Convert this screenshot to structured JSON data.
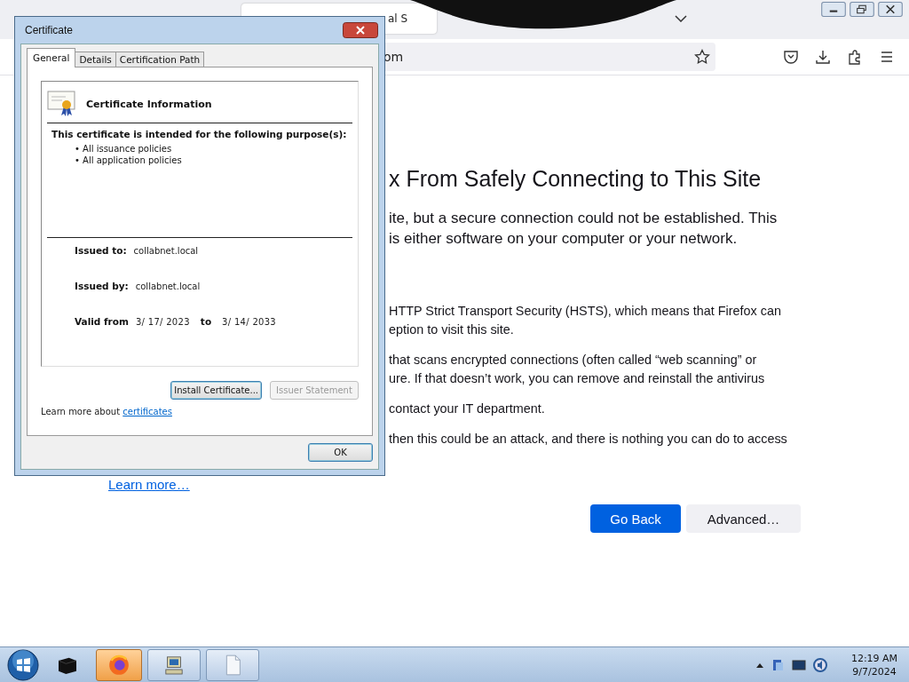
{
  "browser": {
    "tab": {
      "title": "al S"
    },
    "address": {
      "value": "om"
    }
  },
  "content": {
    "heading": "x From Safely Connecting to This Site",
    "paragraphs": [
      {
        "kind": "lead",
        "lines": [
          "ite, but a secure connection could not be established. This",
          "is either software on your computer or your network."
        ]
      },
      {
        "kind": "body",
        "lines": [
          "HTTP Strict Transport Security (HSTS), which means that Firefox can",
          "eption to visit this site."
        ]
      },
      {
        "kind": "body",
        "lines": [
          "that scans encrypted connections (often called “web scanning” or",
          "ure. If that doesn’t work, you can remove and reinstall the antivirus"
        ]
      },
      {
        "kind": "body",
        "lines": [
          "contact your IT department."
        ]
      },
      {
        "kind": "body",
        "lines": [
          "then this could be an attack, and there is nothing you can do to access"
        ]
      }
    ],
    "learn_more": "Learn more…",
    "buttons": [
      {
        "label": "Go Back",
        "kind": "primary"
      },
      {
        "label": "Advanced…",
        "kind": "secondary"
      }
    ]
  },
  "dialog": {
    "title": "Certificate",
    "tabs": [
      {
        "label": "General",
        "selected": true
      },
      {
        "label": "Details",
        "selected": false
      },
      {
        "label": "Certification Path",
        "selected": false
      }
    ],
    "section_title": "Certificate Information",
    "purpose_heading": "This certificate is intended for the following purpose(s):",
    "purposes": [
      "• All issuance policies",
      "• All application policies"
    ],
    "fields": [
      {
        "label": "Issued to:",
        "value": "collabnet.local"
      },
      {
        "label": "Issued by:",
        "value": "collabnet.local"
      }
    ],
    "validity": {
      "label": "Valid from",
      "from": "3/ 17/ 2023",
      "separator": "to",
      "to": "3/ 14/ 2033"
    },
    "buttons": [
      {
        "label": "Install Certificate...",
        "disabled": false
      },
      {
        "label": "Issuer Statement",
        "disabled": true
      }
    ],
    "learn_more": {
      "text": "Learn more about",
      "link": "certificates"
    },
    "ok": "OK"
  },
  "taskbar": {
    "apps": [
      {
        "kind": "box",
        "open": false,
        "selected": false
      },
      {
        "kind": "firefox",
        "open": true,
        "selected": true
      },
      {
        "kind": "computer",
        "open": true,
        "selected": false
      },
      {
        "kind": "document",
        "open": true,
        "selected": false
      }
    ],
    "clock": {
      "time": "12:19 AM",
      "date": "9/7/2024"
    }
  }
}
